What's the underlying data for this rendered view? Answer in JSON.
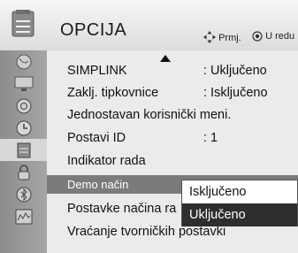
{
  "header": {
    "title": "OPCIJA",
    "hint_nav": "Prmj.",
    "hint_ok": "U redu"
  },
  "sidebar": {
    "icons": [
      "satellite-dish-icon",
      "monitor-icon",
      "speaker-icon",
      "clock-icon",
      "options-icon",
      "lock-icon",
      "bluetooth-icon",
      "sound-wave-icon"
    ],
    "active_index": 4
  },
  "menu": {
    "items": [
      {
        "label": "SIMPLINK",
        "value": ": Uključeno"
      },
      {
        "label": "Zaklj. tipkovnice",
        "value": ": Isključeno"
      },
      {
        "label": "Jednostavan korisnički meni.",
        "value": ""
      },
      {
        "label": "Postavi ID",
        "value": ": 1"
      },
      {
        "label": "Indikator rada",
        "value": ""
      },
      {
        "label": "Demo način",
        "value": ""
      },
      {
        "label": "Postavke načina ra",
        "value": ""
      },
      {
        "label": "Vraćanje tvorničkih postavki",
        "value": ""
      }
    ],
    "selected_index": 5
  },
  "dropdown": {
    "options": [
      "Isključeno",
      "Uključeno"
    ],
    "selected_index": 1
  },
  "colors": {
    "selected_row": "#7b7b7b",
    "dropdown_active": "#2e2e2e",
    "panel_bg": "#ebebeb"
  }
}
